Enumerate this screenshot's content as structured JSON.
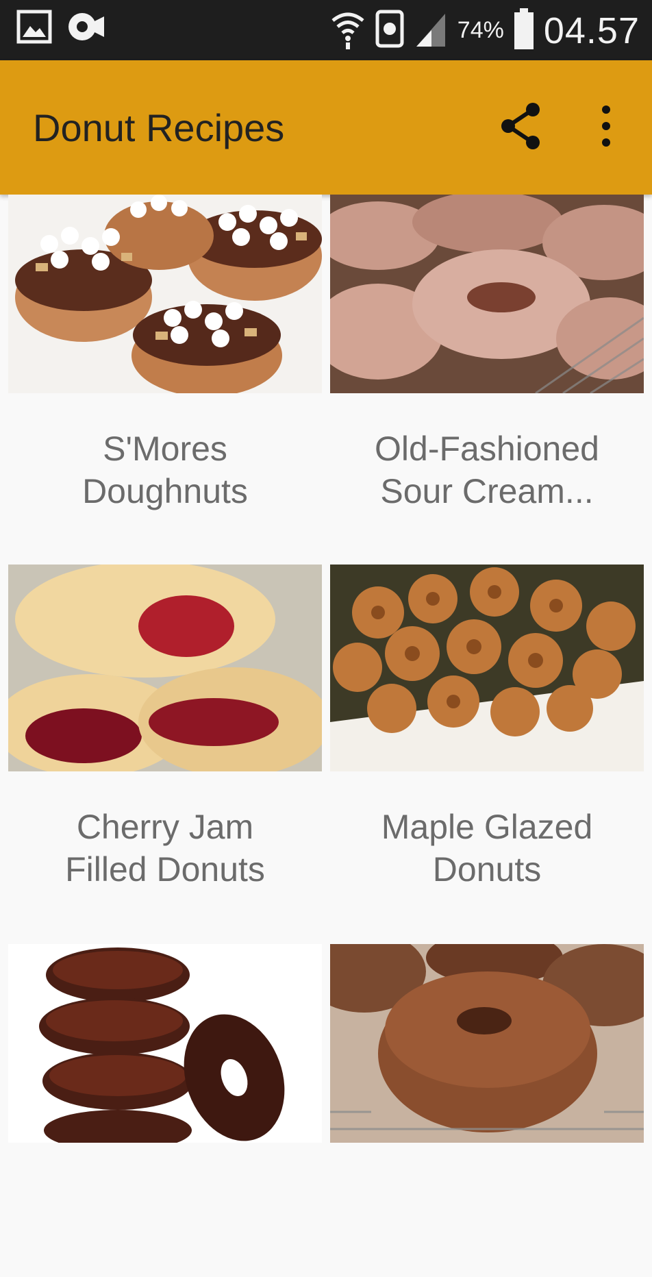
{
  "status_bar": {
    "battery_percent": "74%",
    "time": "04.57",
    "icons": [
      "gallery-icon",
      "video-recorder-icon",
      "wifi-icon",
      "nfc-icon",
      "signal-icon",
      "battery-icon"
    ]
  },
  "app_bar": {
    "title": "Donut Recipes",
    "actions": [
      "share-icon",
      "more-vert-icon"
    ],
    "color": "#dd9b12"
  },
  "recipes": [
    {
      "title_line1": "S'Mores",
      "title_line2": "Doughnuts"
    },
    {
      "title_line1": "Old-Fashioned",
      "title_line2": "Sour Cream..."
    },
    {
      "title_line1": "Cherry Jam",
      "title_line2": "Filled Donuts"
    },
    {
      "title_line1": "Maple Glazed",
      "title_line2": "Donuts"
    },
    {
      "title_line1": "",
      "title_line2": ""
    },
    {
      "title_line1": "",
      "title_line2": ""
    }
  ]
}
